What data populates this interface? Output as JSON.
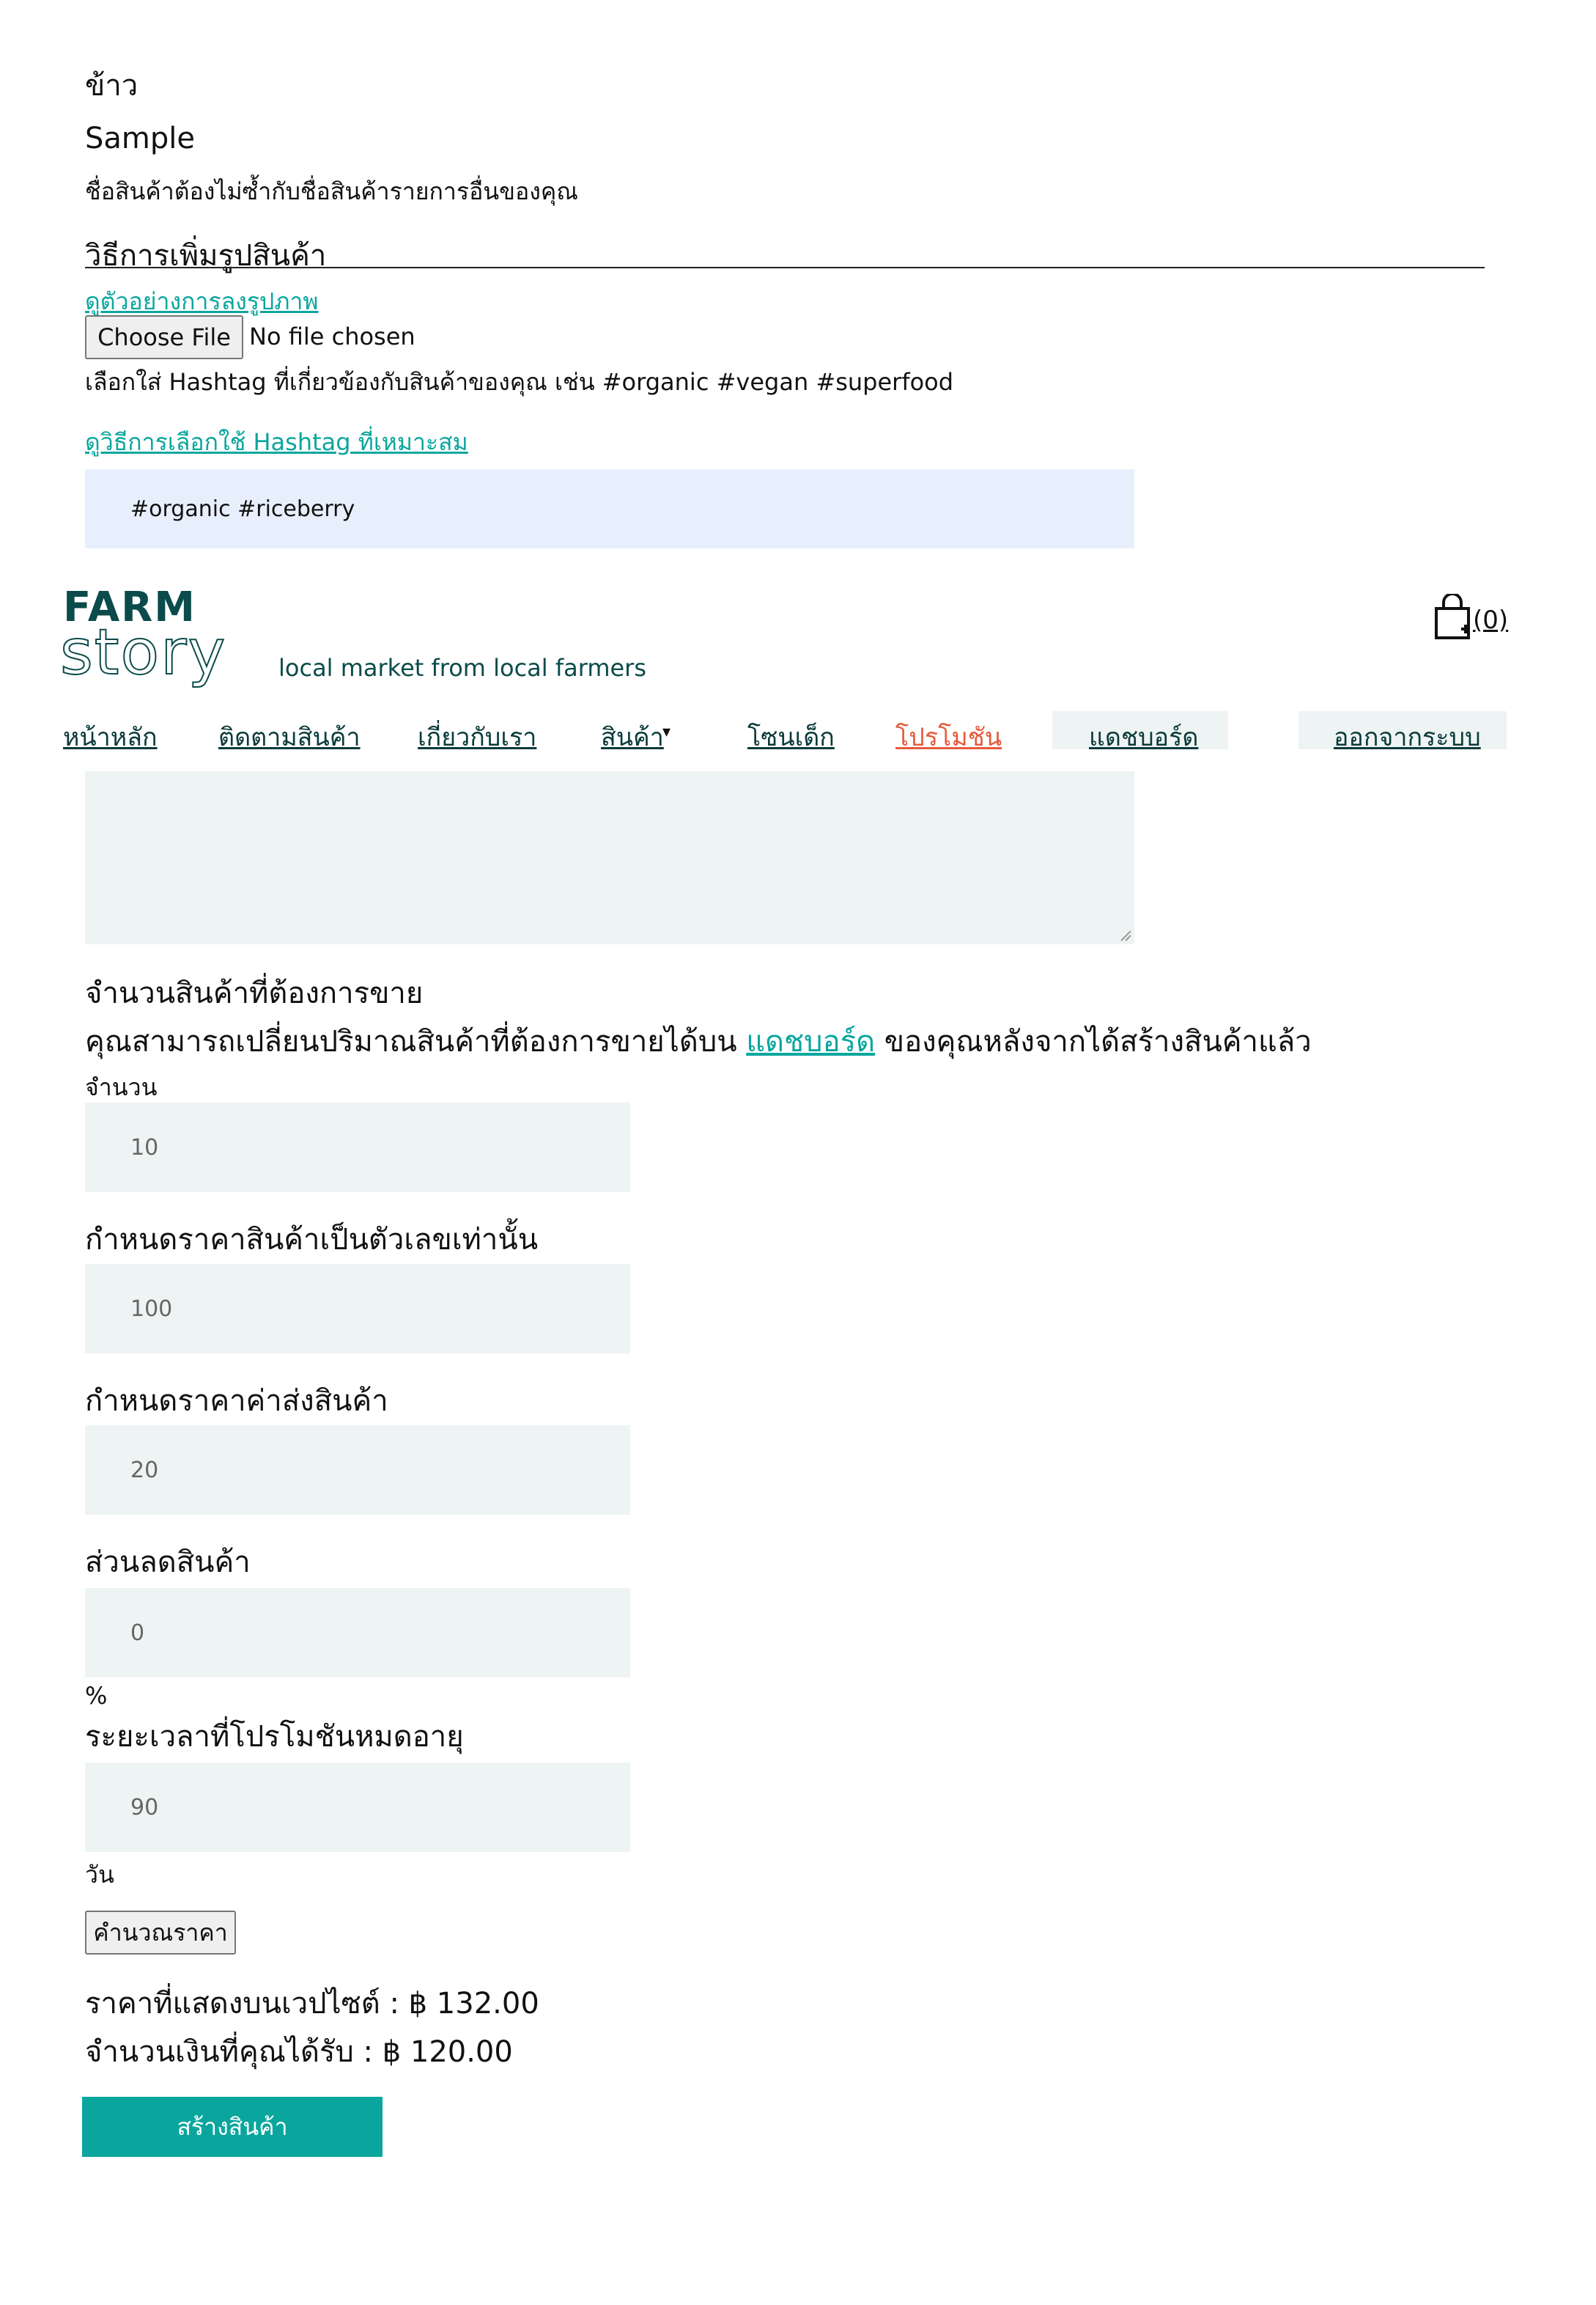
{
  "form": {
    "category_value": "ข้าว",
    "product_name_value": "Sample",
    "product_name_hint": "ชื่อสินค้าต้องไม่ซ้ำกับชื่อสินค้ารายการอื่นของคุณ",
    "image_section_title": "วิธีการเพิ่มรูปสินค้า",
    "image_example_link": "ดูตัวอย่างการลงรูปภาพ",
    "choose_file_label": "Choose File",
    "no_file_text": "No file chosen",
    "hashtag_hint": "เลือกใส่ Hashtag ที่เกี่ยวข้องกับสินค้าของคุณ เช่น #organic #vegan #superfood",
    "hashtag_howto_link": "ดูวิธีการเลือกใช้ Hashtag ที่เหมาะสม",
    "hashtag_value": "#organic #riceberry",
    "quantity_title": "จำนวนสินค้าที่ต้องการขาย",
    "quantity_note_before": "คุณสามารถเปลี่ยนปริมาณสินค้าที่ต้องการขายได้บน ",
    "quantity_note_link": "แดชบอร์ด",
    "quantity_note_after": " ของคุณหลังจากได้สร้างสินค้าแล้ว",
    "quantity_label": "จำนวน",
    "quantity_value": "10",
    "price_title": "กำหนดราคาสินค้าเป็นตัวเลขเท่านั้น",
    "price_value": "100",
    "shipping_title": "กำหนดราคาค่าส่งสินค้า",
    "shipping_value": "20",
    "discount_title": "ส่วนลดสินค้า",
    "discount_value": "0",
    "discount_unit": "%",
    "promo_title": "ระยะเวลาที่โปรโมชันหมดอายุ",
    "promo_value": "90",
    "promo_unit": "วัน",
    "calc_button": "คำนวณราคา",
    "display_price": "ราคาที่แสดงบนเวปไซต์ : ฿ 132.00",
    "received_amount": "จำนวนเงินที่คุณได้รับ : ฿ 120.00",
    "create_button": "สร้างสินค้า"
  },
  "header": {
    "logo_top": "FARM",
    "logo_bottom": "story",
    "tagline": "local market from local farmers",
    "cart_count": "(0)",
    "nav": {
      "home": "หน้าหลัก",
      "follow": "ติดตามสินค้า",
      "about": "เกี่ยวกับเรา",
      "products": "สินค้า",
      "kids": "โซนเด็ก",
      "promotion": "โปรโมชัน",
      "dashboard": "แดชบอร์ด",
      "logout": "ออกจากระบบ"
    }
  },
  "colors": {
    "brand": "#0b4b4b",
    "accent": "#0aa69e",
    "promo": "#e65a3c",
    "input_bg": "#eef4f3",
    "hashtag_bg": "#e8effc"
  }
}
